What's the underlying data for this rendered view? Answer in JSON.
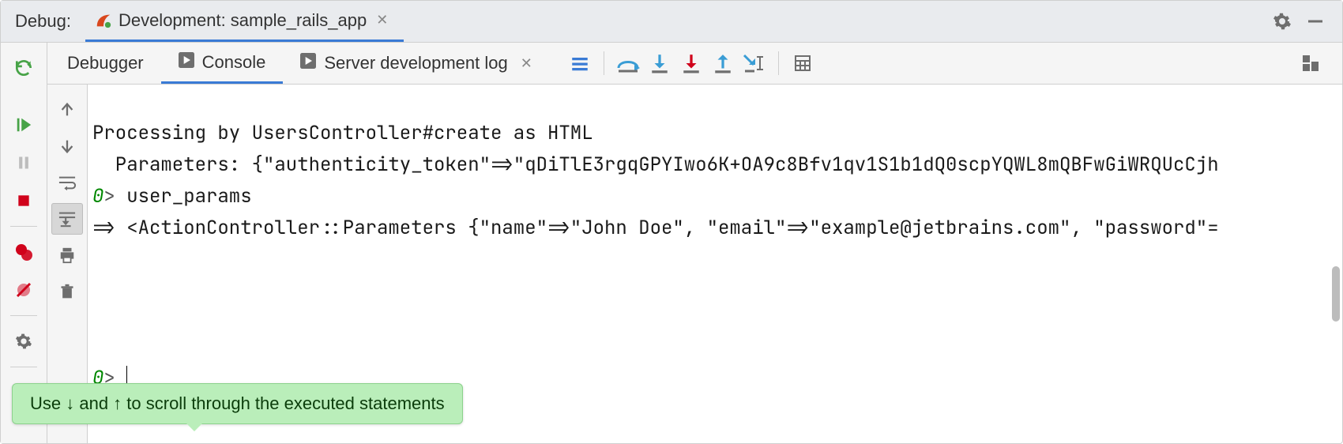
{
  "title": {
    "label": "Debug:",
    "tab_label": "Development: sample_rails_app"
  },
  "tabs": {
    "debugger": "Debugger",
    "console": "Console",
    "server_log": "Server development log"
  },
  "console": {
    "lines": {
      "l1": "Processing by UsersController#create as HTML",
      "l2": "  Parameters: {\"authenticity_token\"=>\"qDiTlE3rgqGPYIwo6K+OA9c8Bfv1qv1S1b1dQ0scpYQWL8mQBFwGiWRQUcCjh",
      "l3_prompt_num": "0",
      "l3_prompt_gt": ">",
      "l3_input": " user_params",
      "l4": "=> <ActionController::Parameters {\"name\"=>\"John Doe\", \"email\"=>\"example@jetbrains.com\", \"password\"=",
      "l5_prompt_num": "0",
      "l5_prompt_gt": ">",
      "l5_input": " "
    }
  },
  "tooltip": {
    "text": "Use ↓ and ↑ to scroll through the executed statements"
  },
  "colors": {
    "accent": "#3a7bd5",
    "green": "#47a347",
    "red": "#d0021b",
    "teal": "#3a9dd5",
    "orange": "#e08b1e",
    "tooltip_bg": "#baeeba"
  }
}
